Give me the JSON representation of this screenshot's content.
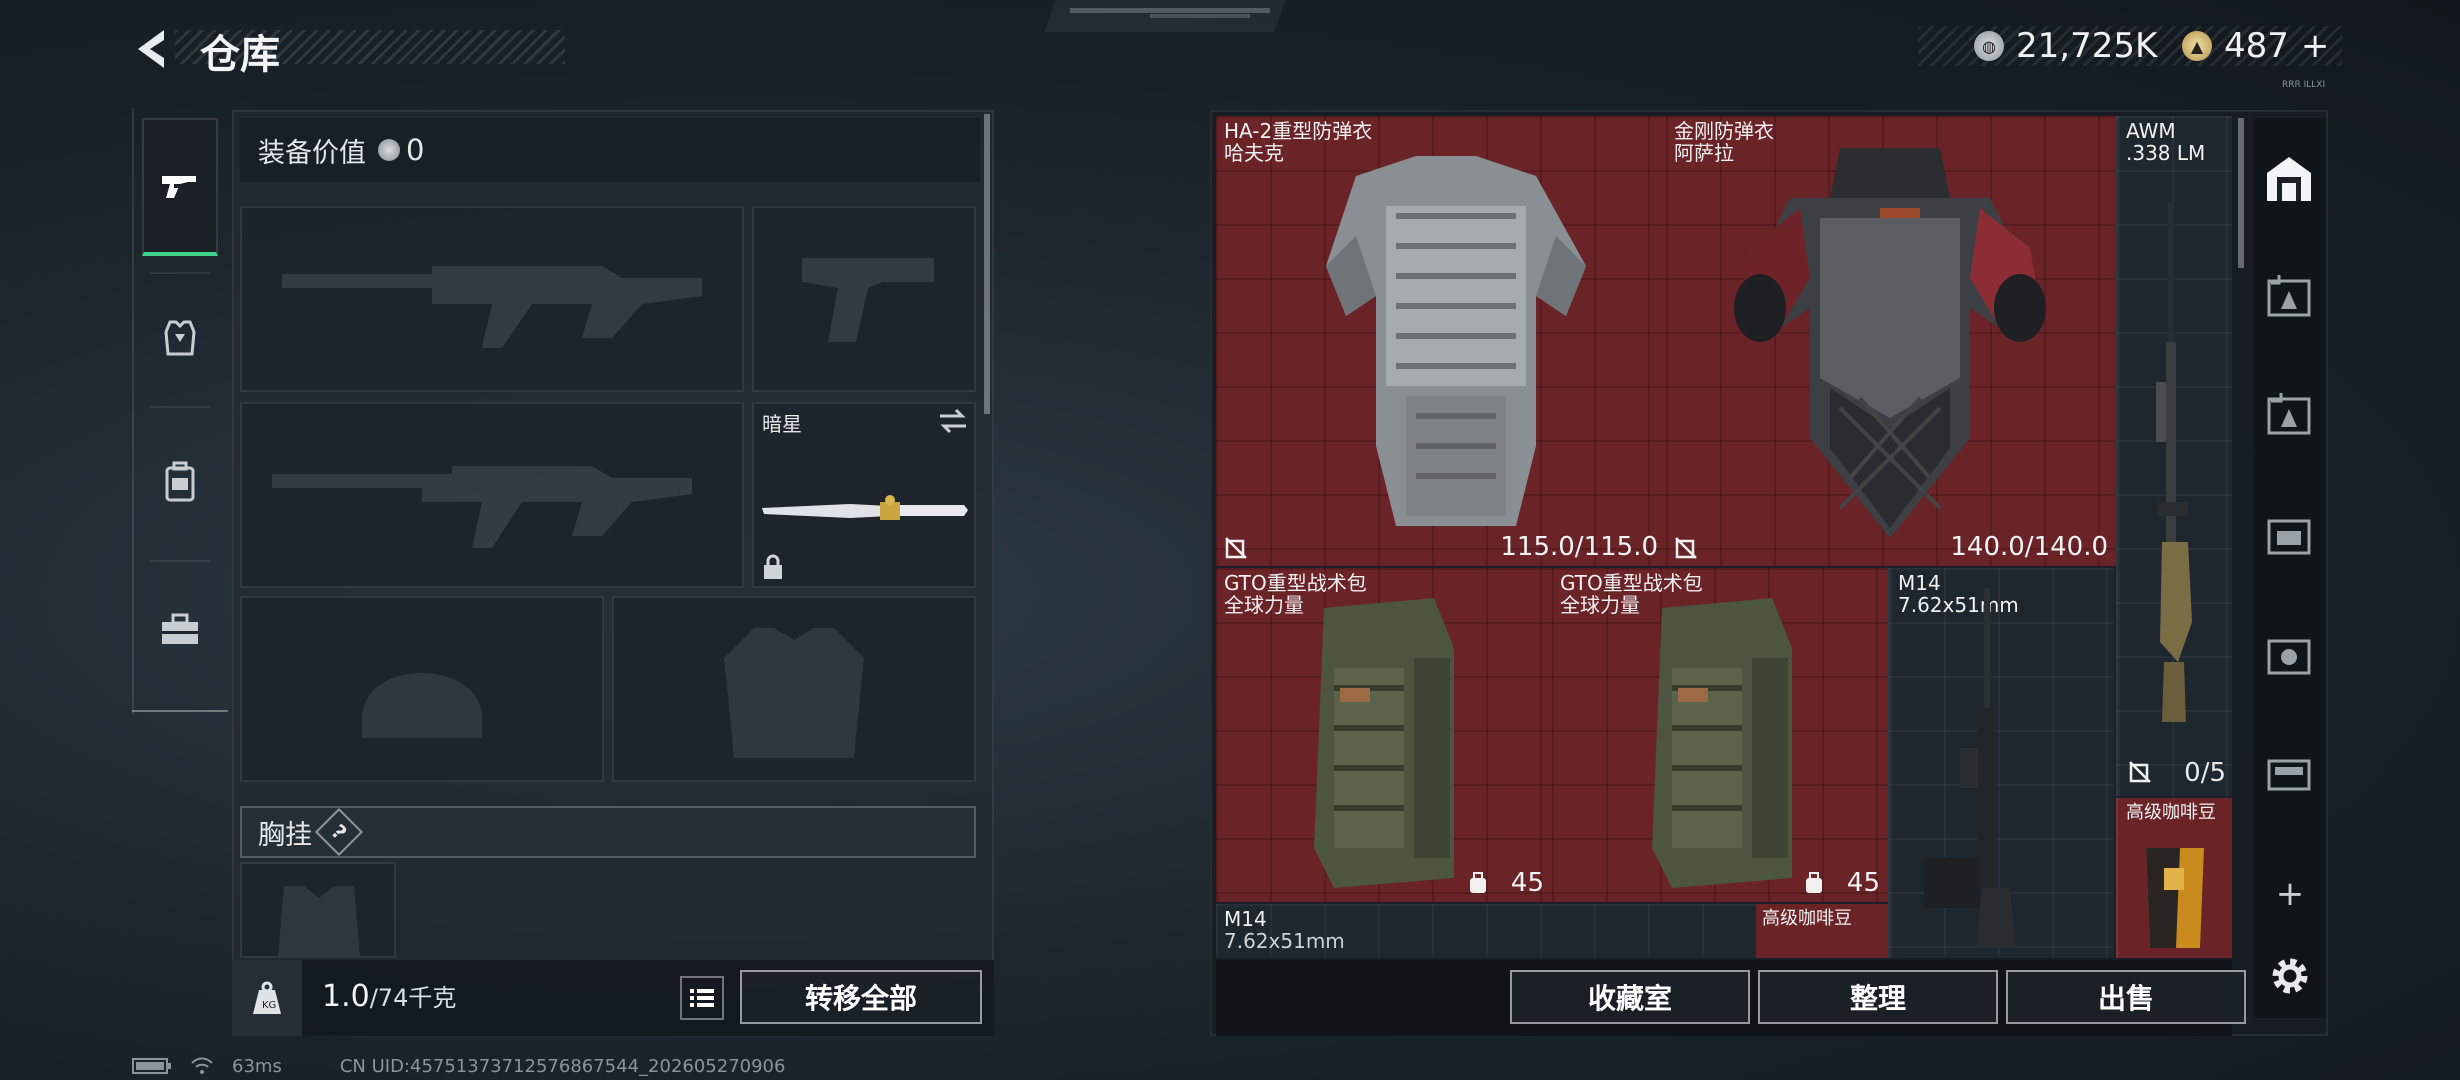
{
  "header": {
    "title": "仓库",
    "currency1": "21,725K",
    "currency2": "487",
    "plus": "+",
    "tiny_label": "RRR ILLXI"
  },
  "left_panel": {
    "equip_value_label": "装备价值",
    "equip_value": "0",
    "melee_name": "暗星",
    "chest_rig_label": "胸挂",
    "help": "?",
    "weight_value": "1.0",
    "weight_capacity": "/74千克",
    "transfer_all": "转移全部"
  },
  "items": [
    {
      "name": "HA-2重型防弹衣",
      "sub": "哈夫克",
      "value": "115.0/115.0"
    },
    {
      "name": "金刚防弹衣",
      "sub": "阿萨拉",
      "value": "140.0/140.0"
    },
    {
      "name": "AWM",
      "sub": ".338 LM",
      "value": "0/5"
    },
    {
      "name": "GTO重型战术包",
      "sub": "全球力量",
      "value": "45"
    },
    {
      "name": "GTO重型战术包",
      "sub": "全球力量",
      "value": "45"
    },
    {
      "name": "M14",
      "sub": "7.62x51mm"
    },
    {
      "name": "高级咖啡豆"
    },
    {
      "name": "M14",
      "sub": "7.62x51mm"
    },
    {
      "name": "高级咖啡豆"
    }
  ],
  "bottom_buttons": {
    "collection": "收藏室",
    "organize": "整理",
    "sell": "出售"
  },
  "right_tabs": {
    "plus": "+"
  },
  "status": {
    "ping": "63ms",
    "uid": "CN UID:4575137371257686754​4_202605270906"
  },
  "colors": {
    "red_cell": "#6a2327",
    "accent_green": "#3fd28a"
  }
}
